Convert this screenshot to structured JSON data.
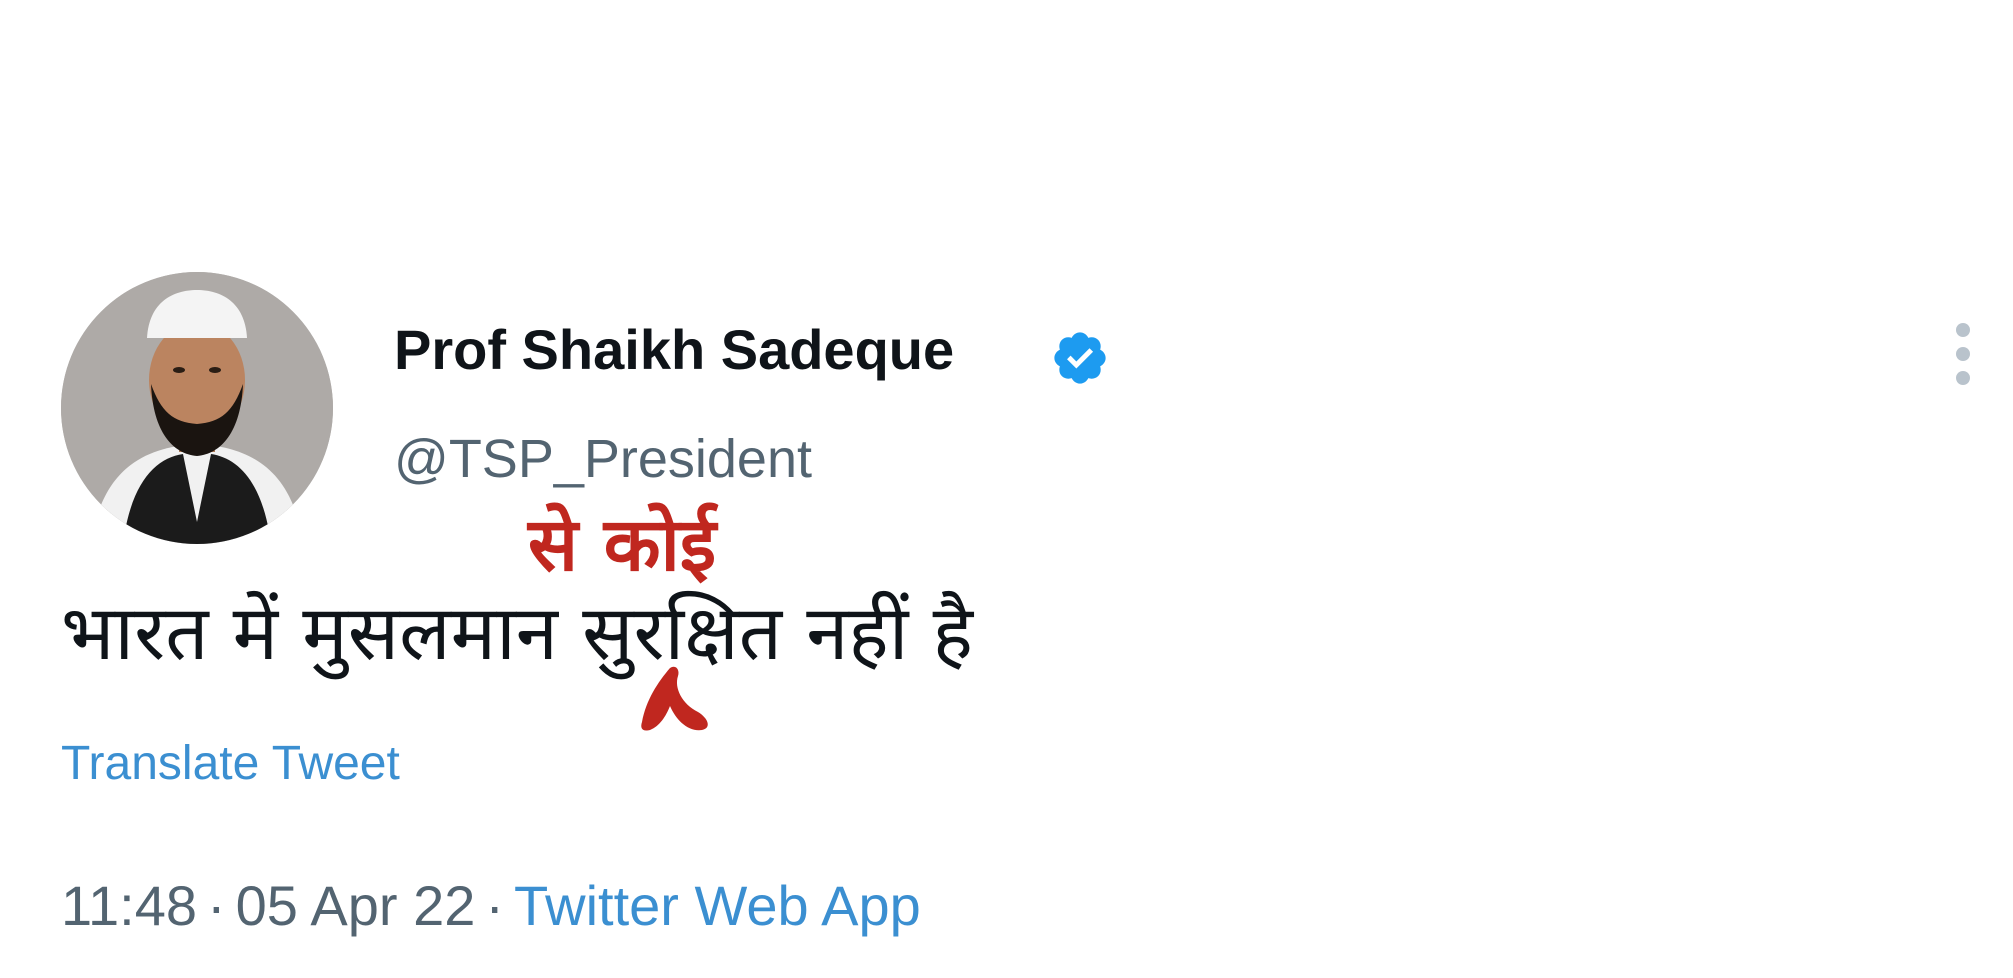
{
  "tweet": {
    "author": {
      "display_name": "Prof Shaikh Sadeque",
      "handle": "@TSP_President",
      "verified": true,
      "avatar": "profile-photo"
    },
    "text": "भारत में मुसलमान सुरक्षित नहीं है",
    "annotation": {
      "inserted_text": "से कोई",
      "color": "#c0271f"
    },
    "translate_label": "Translate Tweet",
    "meta": {
      "time": "11:48",
      "separator": "·",
      "date": "05 Apr 22",
      "source": "Twitter Web App"
    }
  },
  "colors": {
    "link": "#3b8fd1",
    "secondary_text": "#536471",
    "verified_badge": "#1d9bf0"
  }
}
